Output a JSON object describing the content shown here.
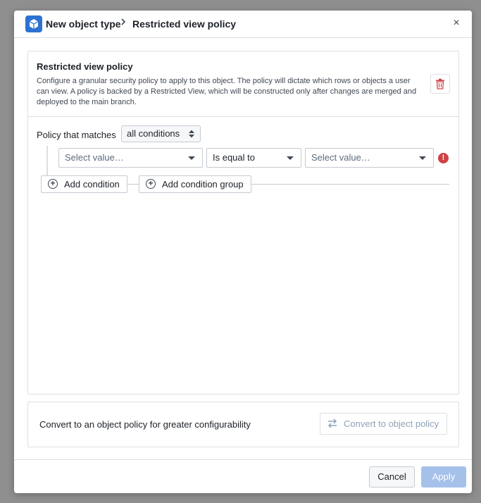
{
  "header": {
    "breadcrumb_parent": "New object type",
    "breadcrumb_current": "Restricted view policy",
    "close_label": "×"
  },
  "policy": {
    "title": "Restricted view policy",
    "description": "Configure a granular security policy to apply to this object. The policy will dictate which rows or objects a user can view. A policy is backed by a Restricted View, which will be constructed only after changes are merged and deployed to the main branch.",
    "match_label": "Policy that matches",
    "match_value": "all conditions",
    "condition": {
      "left_value": "Select value…",
      "operator": "Is equal to",
      "right_value": "Select value…",
      "error_glyph": "!"
    },
    "add_condition_label": "Add condition",
    "add_condition_group_label": "Add condition group"
  },
  "convert": {
    "text": "Convert to an object policy for greater configurability",
    "button_label": "Convert to object policy"
  },
  "footer": {
    "cancel_label": "Cancel",
    "apply_label": "Apply"
  },
  "colors": {
    "primary": "#2d72d2",
    "error": "#cd4246",
    "apply_disabled": "#a5c1ea"
  }
}
